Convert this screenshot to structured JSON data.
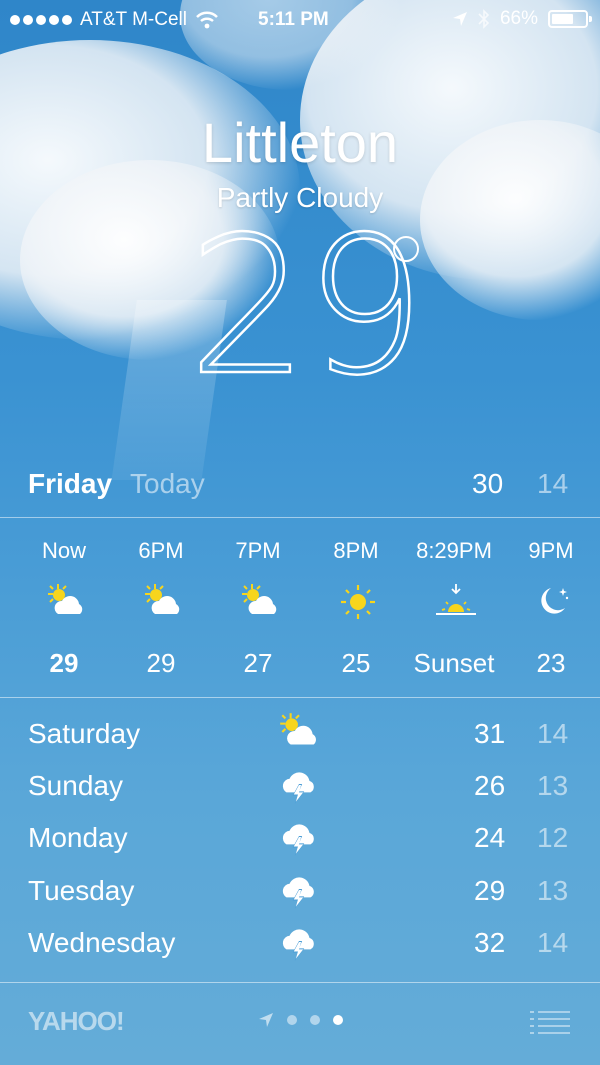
{
  "status_bar": {
    "carrier": "AT&T M-Cell",
    "time": "5:11 PM",
    "battery": "66%",
    "battery_level": 0.66,
    "icons": [
      "signal-dots-icon",
      "wifi-icon",
      "location-arrow-icon",
      "bluetooth-icon",
      "battery-icon"
    ]
  },
  "current": {
    "city": "Littleton",
    "condition": "Partly Cloudy",
    "temperature": "29"
  },
  "today": {
    "day": "Friday",
    "label": "Today",
    "high": "30",
    "low": "14"
  },
  "hourly": [
    {
      "time": "Now",
      "icon": "partly-cloudy-icon",
      "value": "29"
    },
    {
      "time": "6PM",
      "icon": "partly-cloudy-icon",
      "value": "29"
    },
    {
      "time": "7PM",
      "icon": "partly-cloudy-icon",
      "value": "27"
    },
    {
      "time": "8PM",
      "icon": "sun-icon",
      "value": "25"
    },
    {
      "time": "8:29PM",
      "icon": "sunset-icon",
      "value": "Sunset"
    },
    {
      "time": "9PM",
      "icon": "moon-icon",
      "value": "23"
    }
  ],
  "daily": [
    {
      "day": "Saturday",
      "icon": "partly-cloudy-icon",
      "high": "31",
      "low": "14"
    },
    {
      "day": "Sunday",
      "icon": "thunderstorm-icon",
      "high": "26",
      "low": "13"
    },
    {
      "day": "Monday",
      "icon": "thunderstorm-icon",
      "high": "24",
      "low": "12"
    },
    {
      "day": "Tuesday",
      "icon": "thunderstorm-icon",
      "high": "29",
      "low": "13"
    },
    {
      "day": "Wednesday",
      "icon": "thunderstorm-icon",
      "high": "32",
      "low": "14"
    }
  ],
  "footer": {
    "brand": "YAHOO!",
    "page_count": 3,
    "current_page": 3
  },
  "colors": {
    "sun": "#f7d51d",
    "sky_top": "#2f86c9",
    "sky_bottom": "#64acd8"
  }
}
